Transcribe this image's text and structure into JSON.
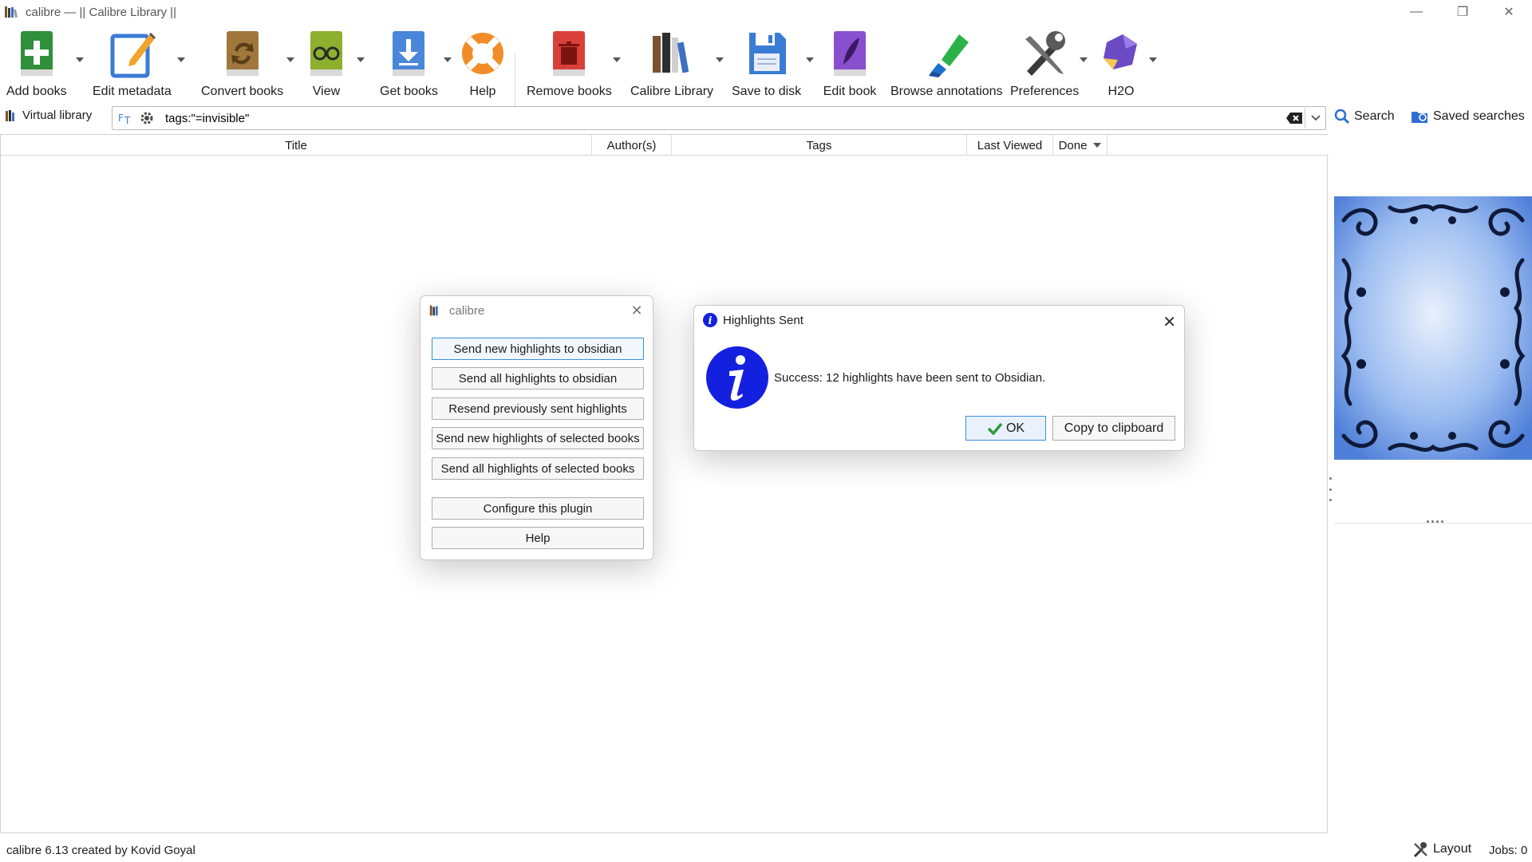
{
  "window": {
    "title": "calibre — || Calibre Library ||",
    "controls": {
      "minimize": "—",
      "maximize": "❐",
      "close": "✕"
    }
  },
  "toolbar": {
    "add_books": "Add books",
    "edit_metadata": "Edit metadata",
    "convert_books": "Convert books",
    "view": "View",
    "get_books": "Get books",
    "help": "Help",
    "remove_books": "Remove books",
    "calibre_library": "Calibre Library",
    "save_to_disk": "Save to disk",
    "edit_book": "Edit book",
    "browse_annotations": "Browse annotations",
    "preferences": "Preferences",
    "h2o": "H2O"
  },
  "search": {
    "virtual_library": "Virtual library",
    "query": "tags:\"=invisible\"",
    "search_label": "Search",
    "saved_searches_label": "Saved searches"
  },
  "columns": [
    "Title",
    "Author(s)",
    "Tags",
    "Last Viewed",
    "Done"
  ],
  "plugin_dialog": {
    "title": "calibre",
    "buttons": [
      "Send new highlights to obsidian",
      "Send all highlights to obsidian",
      "Resend previously sent highlights",
      "Send new highlights of selected books",
      "Send all highlights of selected books",
      "Configure this plugin",
      "Help"
    ]
  },
  "info_dialog": {
    "title": "Highlights Sent",
    "message": "Success: 12 highlights have been sent to Obsidian.",
    "ok_label": "OK",
    "copy_label": "Copy to clipboard"
  },
  "status": {
    "left": "calibre 6.13 created by Kovid Goyal",
    "layout_label": "Layout",
    "jobs": "Jobs: 0"
  },
  "colors": {
    "accent": "#3c8fde",
    "info_blue": "#1420e0",
    "cover_blue": "#6f9ce8"
  }
}
